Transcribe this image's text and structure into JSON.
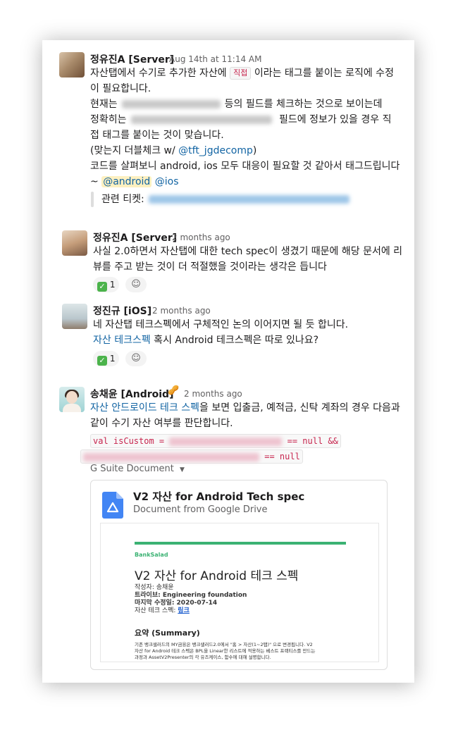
{
  "messages": [
    {
      "author": "정유진A [Server]",
      "time": "Aug 14th at 11:14 AM",
      "l1_pre": "자산탭에서 수기로 추가한 자산에 ",
      "tag": "직접",
      "l1_post": " 이라는 태그를 붙이는 로직에 수정",
      "l2": "이 필요합니다.",
      "l3_pre": "현재는",
      "l3_post": "등의 필드를 체크하는 것으로 보이는데",
      "l4_pre": "정확히는",
      "l4_post": " 필드에 정보가 있을 경우 직",
      "l5": "접 태그를 붙이는 것이 맞습니다.",
      "l6_pre": "(맞는지 더블체크 w/ ",
      "l6_mention": "@tft_jgdecomp",
      "l6_post": ")",
      "l7": "코드를 살펴보니 android, ios 모두 대응이 필요할 것 같아서 태그드립니다",
      "l8_pre": "~ ",
      "l8_mention1": "@android",
      "l8_mention2": "@ios",
      "quote_label": "관련 티켓:"
    },
    {
      "author": "정유진A [Server]",
      "time": "2 months ago",
      "l1": "사실 2.0하면서 자산탭에 대한 tech spec이 생겼기 때문에 해당 문서에 리",
      "l2": "뷰를 주고 받는 것이 더 적절했을 것이라는 생각은 듭니다",
      "reaction_count": "1"
    },
    {
      "author": "정진규 [iOS]",
      "time": "2 months ago",
      "l1": "네 자산탭 테크스펙에서 구체적인 논의 이어지면 될 듯 합니다.",
      "l2_link": "자산 테크스펙",
      "l2_post": " 혹시 Android 테크스펙은 따로 있나요?",
      "reaction_count": "1"
    },
    {
      "author": "송채윤 [Android]",
      "status_emoji": "🥜",
      "time": "2 months ago",
      "l1_link": "자산 안드로이드 테크 스펙",
      "l1_post": "을 보면 입출금, 예적금, 신탁 계좌의 경우 다음과",
      "l2": "같이 수기 자산 여부를 판단합니다.",
      "code1_pre": "val isCustom = ",
      "code1_post": " == null &&",
      "code2_post": " == null",
      "gsuite_label": "G Suite Document",
      "attachment": {
        "title": "V2 자산 for Android Tech spec",
        "subtitle": "Document from Google Drive",
        "preview": {
          "brand": "BankSalad",
          "title": "V2 자산 for Android 테크 스펙",
          "author": "작성자: 송채윤",
          "tribe": "트라이브: Engineering foundation",
          "modified": "마지막 수정일: 2020-07-14",
          "spec_label": "자산 테크 스펙: ",
          "spec_link": "링크",
          "summary_heading": "요약 (Summary)",
          "summary_l1": "기존 뱅크샐러드의 MY금융은 뱅크샐러드2.0에서 \"홈 > 자산(1~2탭)\" 으로 변경됩니다. V2",
          "summary_l2": "자산 for Android 테크 스펙은 BPL을 Linear한 리스트에 적용하는 베스트 프랙티스를 만드는",
          "summary_l3": "과정과 AssetV2Presenter의 각 유즈케이스, 함수에 대해 설명합니다."
        }
      }
    }
  ],
  "colors": {
    "link": "#1264a3",
    "mention_highlight": "#fdf0c0",
    "code_text": "#c7254e",
    "reaction_check": "#4bb34b",
    "brand_green": "#3bb273",
    "drive_blue": "#4285f4"
  },
  "icons": [
    "check-mark-reaction-icon",
    "add-reaction-icon",
    "chevron-down-icon",
    "google-docs-icon",
    "peanut-status-icon"
  ]
}
